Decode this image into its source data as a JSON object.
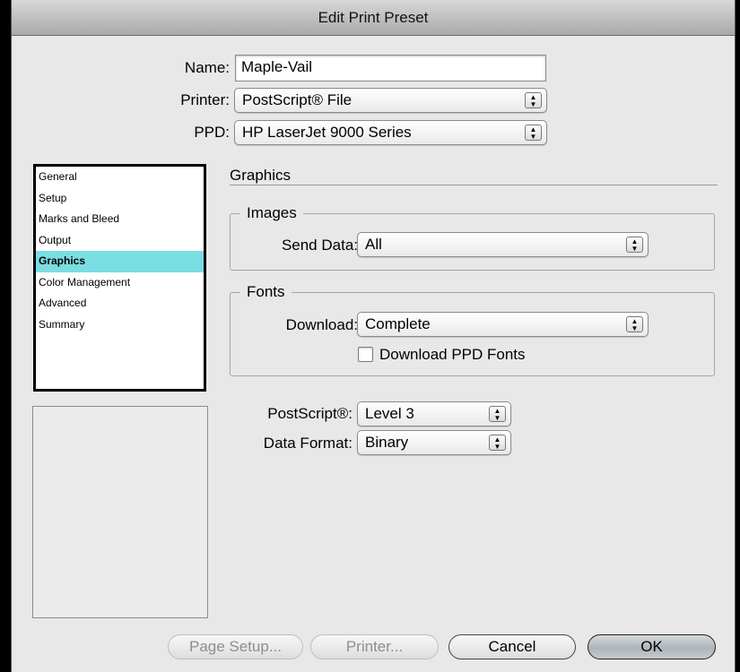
{
  "window": {
    "title": "Edit Print Preset"
  },
  "header": {
    "name_label": "Name:",
    "name_value": "Maple-Vail",
    "printer_label": "Printer:",
    "printer_value": "PostScript® File",
    "ppd_label": "PPD:",
    "ppd_value": "HP LaserJet 9000 Series"
  },
  "sidebar": {
    "items": [
      {
        "label": "General"
      },
      {
        "label": "Setup"
      },
      {
        "label": "Marks and Bleed"
      },
      {
        "label": "Output"
      },
      {
        "label": "Graphics"
      },
      {
        "label": "Color Management"
      },
      {
        "label": "Advanced"
      },
      {
        "label": "Summary"
      }
    ],
    "selected": "Graphics",
    "selection_color": "#7adde2"
  },
  "panel": {
    "title": "Graphics",
    "images": {
      "legend": "Images",
      "send_data_label": "Send Data:",
      "send_data_value": "All"
    },
    "fonts": {
      "legend": "Fonts",
      "download_label": "Download:",
      "download_value": "Complete",
      "download_ppd_label": "Download PPD Fonts",
      "download_ppd_checked": false
    },
    "postscript_label": "PostScript®:",
    "postscript_value": "Level 3",
    "data_format_label": "Data Format:",
    "data_format_value": "Binary"
  },
  "buttons": {
    "page_setup": "Page Setup...",
    "printer": "Printer...",
    "cancel": "Cancel",
    "ok": "OK"
  },
  "icons": {
    "popup_arrows": "updown-arrows-icon"
  }
}
